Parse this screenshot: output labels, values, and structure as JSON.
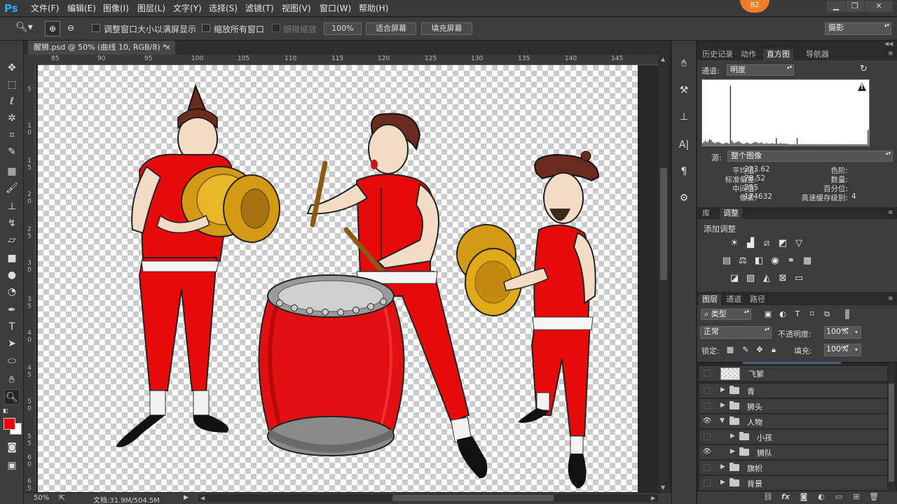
{
  "app": {
    "logo": "Ps",
    "notification_count": "82"
  },
  "menu": [
    "文件(F)",
    "编辑(E)",
    "图像(I)",
    "图层(L)",
    "文字(Y)",
    "选择(S)",
    "滤镜(T)",
    "视图(V)",
    "窗口(W)",
    "帮助(H)"
  ],
  "window_controls": {
    "minimize": "▁",
    "restore": "❐",
    "close": "✕"
  },
  "options": {
    "resize_windows": "调整窗口大小以满屏显示",
    "zoom_all": "缩放所有窗口",
    "scrubby_zoom": "细微缩放",
    "zoom_100": "100%",
    "fit_screen": "适合屏幕",
    "fill_screen": "填充屏幕",
    "workspace": "摄影"
  },
  "document": {
    "tab_title": "醒狮.psd @ 50% (曲线 10, RGB/8) *",
    "tab_close": "×",
    "zoom": "50%",
    "doc_size": "文档:31.9M/504.5M"
  },
  "ruler": {
    "top": [
      "85",
      "90",
      "95",
      "100",
      "105",
      "110",
      "115",
      "120",
      "125",
      "130",
      "135",
      "140",
      "145"
    ],
    "left": [
      "5",
      "1 0",
      "1 5",
      "2 0",
      "2 5",
      "3 0",
      "3 5",
      "4 0",
      "4 5",
      "5 0",
      "5 5",
      "6 0",
      "6 5"
    ]
  },
  "histogram_panel": {
    "tabs": [
      "历史记录",
      "动作",
      "直方图",
      "导航器"
    ],
    "active_tab": "直方图",
    "channel_label": "通道:",
    "channel_value": "明度",
    "source_label": "源:",
    "source_value": "整个图像",
    "warning": "!",
    "stats_left": [
      {
        "label": "平均值:",
        "value": "223.62"
      },
      {
        "label": "标准偏差:",
        "value": "78.52"
      },
      {
        "label": "中间值:",
        "value": "255"
      },
      {
        "label": "像素:",
        "value": "174632"
      }
    ],
    "stats_right": [
      {
        "label": "色阶:",
        "value": ""
      },
      {
        "label": "数量:",
        "value": ""
      },
      {
        "label": "百分位:",
        "value": ""
      },
      {
        "label": "高速缓存级别:",
        "value": "4"
      }
    ],
    "bars": [
      0.04,
      0.06,
      0.08,
      0.05,
      0.07,
      0.1,
      0.09,
      0.06,
      0.05,
      0.04,
      0.05,
      0.06,
      0.05,
      0.04,
      0.03,
      0.03,
      0.04,
      0.05,
      0.04,
      0.03,
      0.95,
      0.08,
      0.05,
      0.04,
      0.05,
      0.06,
      0.07,
      0.05,
      0.04,
      0.03,
      0.03,
      0.04,
      0.05,
      0.04,
      0.03,
      0.03,
      0.04,
      0.05,
      0.06,
      0.05,
      0.04,
      0.04,
      0.05,
      0.04,
      0.03,
      0.03,
      0.04,
      0.03,
      0.03,
      0.03,
      0.04,
      0.03,
      0.03,
      0.12,
      0.03,
      0.03,
      0.04,
      0.03,
      0.03,
      0.03,
      0.03,
      0.03,
      0.02,
      0.02,
      0.02,
      0.02,
      0.02,
      0.02,
      0.12,
      0.02,
      0.02,
      0.02,
      0.02,
      0.02,
      0.02,
      0.02,
      0.02,
      0.02,
      0.02,
      0.02,
      0.02,
      0.02,
      0.02,
      0.02,
      0.02,
      0.02,
      0.02,
      0.02,
      0.02,
      0.02,
      0.02,
      0.02,
      0.02,
      0.02,
      0.02,
      0.02,
      0.02,
      0.02,
      0.02,
      0.02,
      0.02,
      0.02,
      0.02,
      0.02,
      0.02,
      0.02,
      0.02,
      0.02,
      0.02,
      0.02,
      0.02,
      0.02,
      0.02,
      0.02,
      0.02,
      0.02,
      0.02,
      0.02,
      0.02,
      0.25
    ]
  },
  "adjust_panel": {
    "tabs": [
      "库",
      "调整"
    ],
    "active_tab": "调整",
    "title": "添加调整",
    "row1": [
      "brightness-icon",
      "levels-icon",
      "curves-icon",
      "exposure-icon",
      "vibrance-icon"
    ],
    "row2": [
      "hue-sat-icon",
      "color-balance-icon",
      "black-white-icon",
      "photo-filter-icon",
      "channel-mixer-icon",
      "color-lookup-icon"
    ],
    "row3": [
      "invert-icon",
      "posterize-icon",
      "threshold-icon",
      "selective-color-icon",
      "gradient-map-icon"
    ]
  },
  "layers_panel": {
    "tabs": [
      "图层",
      "通道",
      "路径"
    ],
    "active_tab": "图层",
    "filter_label": "类型",
    "blend_mode": "正常",
    "opacity_label": "不透明度:",
    "opacity_value": "100%",
    "lock_label": "锁定:",
    "fill_label": "填充:",
    "fill_value": "100%",
    "layers": [
      {
        "name": "飞絮",
        "visible": false,
        "type": "layer",
        "expanded": false,
        "indent": 0
      },
      {
        "name": "青",
        "visible": false,
        "type": "group",
        "expanded": false,
        "indent": 0
      },
      {
        "name": "狮头",
        "visible": false,
        "type": "group",
        "expanded": false,
        "indent": 0
      },
      {
        "name": "人物",
        "visible": true,
        "type": "group",
        "expanded": true,
        "indent": 0
      },
      {
        "name": "小孩",
        "visible": false,
        "type": "group",
        "expanded": false,
        "indent": 1
      },
      {
        "name": "狮队",
        "visible": true,
        "type": "group",
        "expanded": false,
        "indent": 1
      },
      {
        "name": "旗帜",
        "visible": false,
        "type": "group",
        "expanded": false,
        "indent": 0
      },
      {
        "name": "背景",
        "visible": false,
        "type": "group",
        "expanded": false,
        "indent": 0
      }
    ],
    "footer": [
      "link-icon",
      "fx-icon",
      "mask-icon",
      "adjustment-icon",
      "group-icon",
      "new-layer-icon",
      "trash-icon"
    ],
    "footer_labels": {
      "fx": "fx"
    }
  }
}
